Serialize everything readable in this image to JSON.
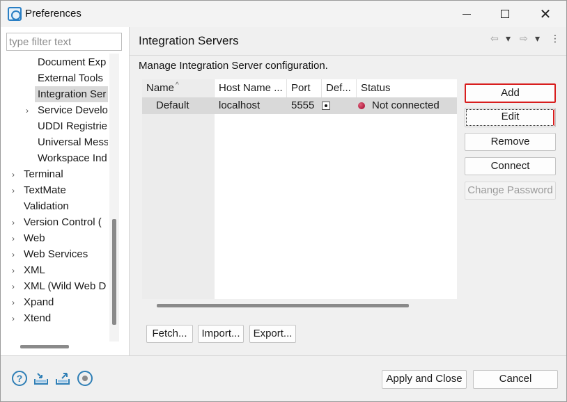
{
  "window": {
    "title": "Preferences",
    "minimize_icon": "minimize-icon",
    "maximize_icon": "maximize-icon",
    "close_glyph": "✕"
  },
  "sidebar": {
    "filter_placeholder": "type filter text",
    "items": [
      {
        "label": "Document Exp",
        "expandable": false,
        "selected": false
      },
      {
        "label": "External Tools",
        "expandable": false,
        "selected": false
      },
      {
        "label": "Integration Ser",
        "expandable": false,
        "selected": true
      },
      {
        "label": "Service Develo",
        "expandable": true,
        "selected": false
      },
      {
        "label": "UDDI Registrie",
        "expandable": false,
        "selected": false
      },
      {
        "label": "Universal Mess",
        "expandable": false,
        "selected": false
      },
      {
        "label": "Workspace Ind",
        "expandable": false,
        "selected": false
      },
      {
        "label": "Terminal",
        "expandable": true,
        "selected": false
      },
      {
        "label": "TextMate",
        "expandable": true,
        "selected": false
      },
      {
        "label": "Validation",
        "expandable": false,
        "selected": false
      },
      {
        "label": "Version Control (",
        "expandable": true,
        "selected": false
      },
      {
        "label": "Web",
        "expandable": true,
        "selected": false
      },
      {
        "label": "Web Services",
        "expandable": true,
        "selected": false
      },
      {
        "label": "XML",
        "expandable": true,
        "selected": false
      },
      {
        "label": "XML (Wild Web D",
        "expandable": true,
        "selected": false
      },
      {
        "label": "Xpand",
        "expandable": true,
        "selected": false
      },
      {
        "label": "Xtend",
        "expandable": true,
        "selected": false
      }
    ]
  },
  "page": {
    "title": "Integration Servers",
    "description": "Manage Integration Server configuration.",
    "nav": {
      "back": "⇦",
      "forward": "⇨",
      "dropdown": "▾",
      "menu": "⋮"
    }
  },
  "table": {
    "columns": [
      "Name",
      "Host Name ...",
      "Port",
      "Def...",
      "Status"
    ],
    "sort_caret": "^",
    "rows": [
      {
        "name": "Default",
        "host": "localhost",
        "port": "5555",
        "default": true,
        "status": "Not connected",
        "status_color": "#b0002a"
      }
    ]
  },
  "side_buttons": {
    "add": "Add",
    "edit": "Edit",
    "remove": "Remove",
    "connect": "Connect",
    "change_password": "Change Password"
  },
  "bottom_buttons": {
    "fetch": "Fetch...",
    "import": "Import...",
    "export": "Export..."
  },
  "footer": {
    "help_glyph": "?",
    "import_prefs_icon": "import-preferences-icon",
    "export_prefs_icon": "export-preferences-icon",
    "record_icon": "record-icon",
    "apply_close": "Apply and Close",
    "cancel": "Cancel"
  },
  "colors": {
    "accent_border": "#d81e1e",
    "icon_blue": "#2f7fb6",
    "selection": "#d9d9d9"
  }
}
